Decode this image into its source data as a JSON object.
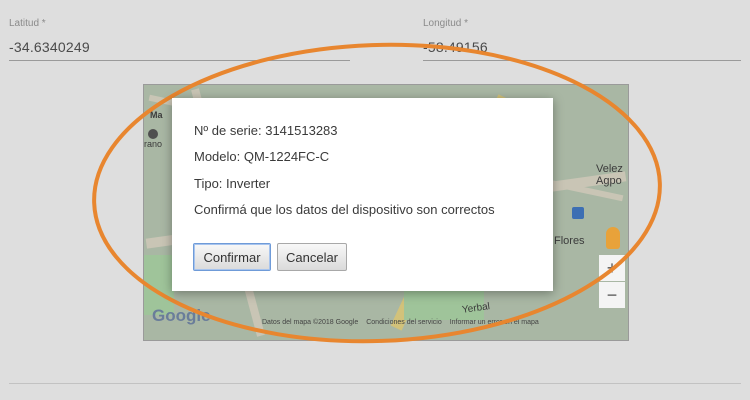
{
  "form": {
    "latitude": {
      "label": "Latitud *",
      "value": "-34.6340249"
    },
    "longitude": {
      "label": "Longitud *",
      "value": "-58.49156"
    }
  },
  "map": {
    "labels": {
      "ma": "Ma",
      "rano": "rano",
      "velez": "Velez",
      "velez2": "Agpo",
      "flores": "Flores",
      "verbal": "Yerbal"
    },
    "zoom_in": "+",
    "zoom_out": "−",
    "logo": "Google",
    "footer": {
      "data": "Datos del mapa ©2018 Google",
      "terms": "Condiciones del servicio",
      "report": "Informar un error en el mapa"
    }
  },
  "modal": {
    "serial": "Nº de serie: 3141513283",
    "model": "Modelo: QM-1224FC-C",
    "type": "Tipo: Inverter",
    "confirm_text": "Confirmá que los datos del dispositivo son correctos",
    "confirm_button": "Confirmar",
    "cancel_button": "Cancelar"
  },
  "colors": {
    "annotation_ellipse": "#e8862f",
    "overlay": "#dedede",
    "focus_border": "#6f9bd8"
  },
  "icons": {
    "map_pin": "map-pin-icon",
    "transit_marker": "transit-marker-icon",
    "street_view": "pegman-icon"
  }
}
